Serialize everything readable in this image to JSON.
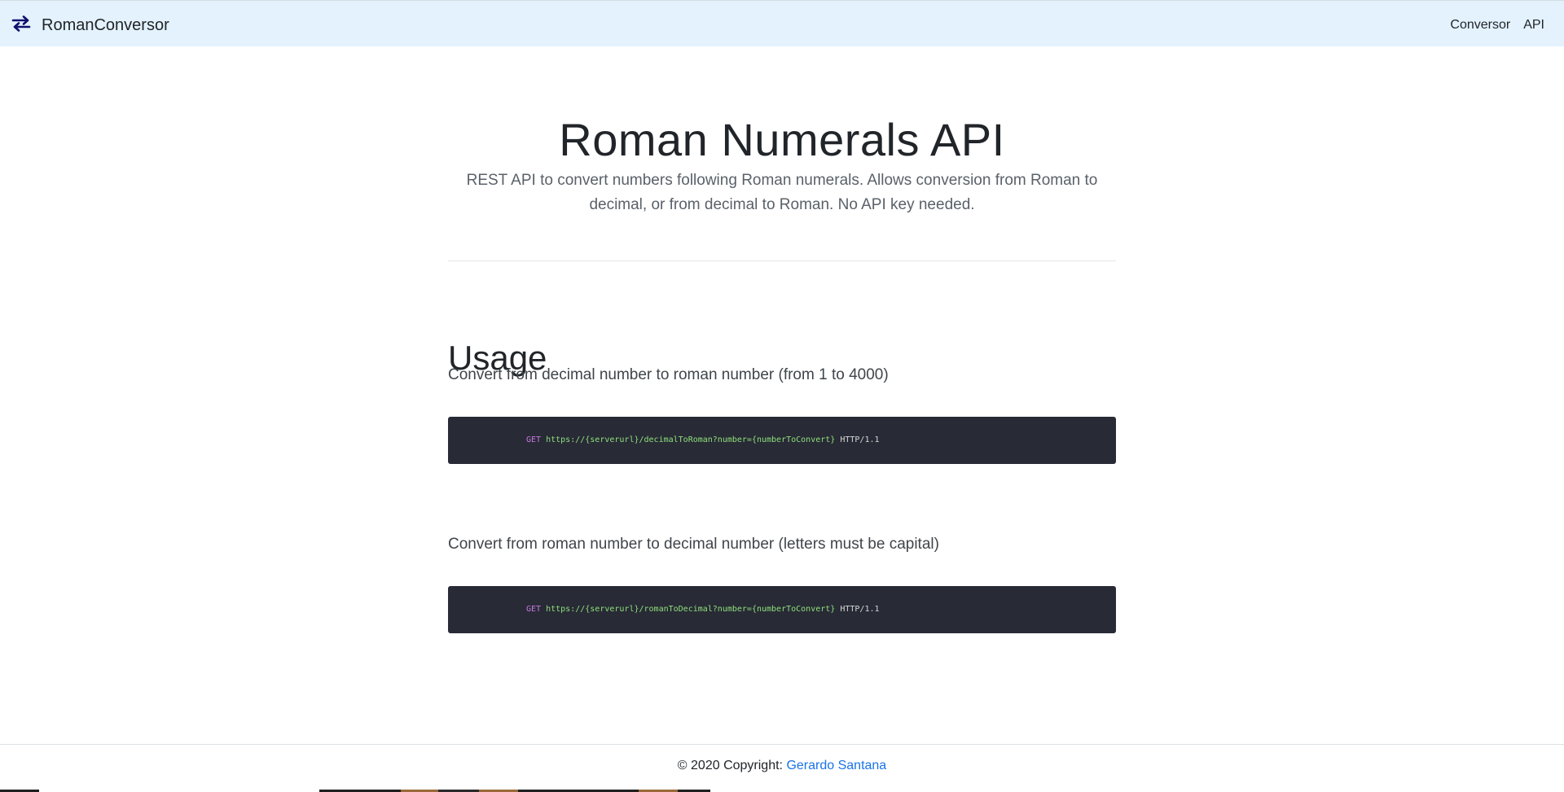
{
  "navbar": {
    "brand": "RomanConversor",
    "brand_icon": "swap-arrows-icon",
    "links": [
      {
        "label": "Conversor"
      },
      {
        "label": "API"
      }
    ],
    "background": "#e3f2fd"
  },
  "header": {
    "title": "Roman Numerals API",
    "lead": "REST API to convert numbers following Roman numerals. Allows conversion from Roman to decimal, or from decimal to Roman. No API key needed."
  },
  "usage": {
    "heading": "Usage",
    "examples": [
      {
        "description": "Convert from decimal number to roman number (from 1 to 4000)",
        "method": "GET",
        "url": "https://{serverurl}/decimalToRoman?number={numberToConvert}",
        "protocol": "HTTP/1.1"
      },
      {
        "description": "Convert from roman number to decimal number (letters must be capital)",
        "method": "GET",
        "url": "https://{serverurl}/romanToDecimal?number={numberToConvert}",
        "protocol": "HTTP/1.1"
      }
    ]
  },
  "footer": {
    "copyright": "© 2020 Copyright:",
    "author": "Gerardo Santana",
    "link_color": "#1a73e8"
  },
  "colors": {
    "code_background": "#282a36",
    "code_method": "#c678dd",
    "code_url": "#8ee07a"
  }
}
